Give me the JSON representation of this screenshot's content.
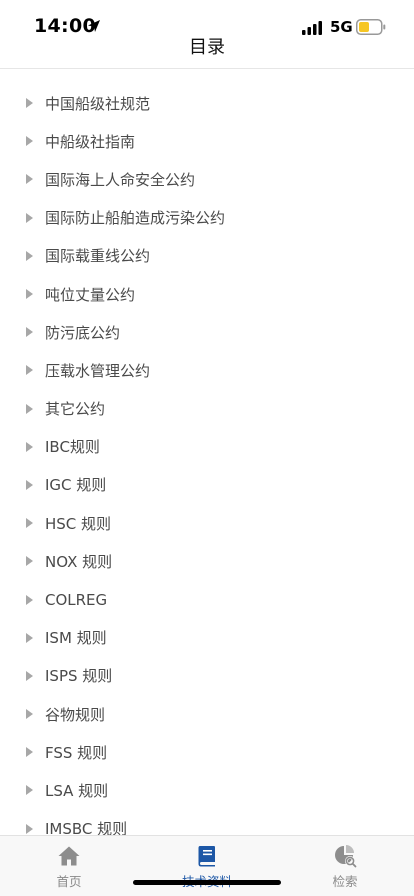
{
  "status_bar": {
    "time": "14:00",
    "network": "5G",
    "icons": [
      "location-arrow-icon",
      "signal-icon",
      "battery-icon"
    ]
  },
  "nav": {
    "title": "目录"
  },
  "catalog": {
    "items": [
      {
        "label": "中国船级社规范"
      },
      {
        "label": "中船级社指南"
      },
      {
        "label": "国际海上人命安全公约"
      },
      {
        "label": "国际防止船舶造成污染公约"
      },
      {
        "label": "国际载重线公约"
      },
      {
        "label": "吨位丈量公约"
      },
      {
        "label": "防污底公约"
      },
      {
        "label": "压载水管理公约"
      },
      {
        "label": "其它公约"
      },
      {
        "label": "IBC规则"
      },
      {
        "label": "IGC 规则"
      },
      {
        "label": "HSC 规则"
      },
      {
        "label": "NOX 规则"
      },
      {
        "label": "COLREG"
      },
      {
        "label": "ISM 规则"
      },
      {
        "label": "ISPS 规则"
      },
      {
        "label": "谷物规则"
      },
      {
        "label": "FSS 规则"
      },
      {
        "label": "LSA 规则"
      },
      {
        "label": "IMSBC 规则"
      }
    ]
  },
  "tab_bar": {
    "tabs": [
      {
        "label": "首页",
        "icon": "home-icon"
      },
      {
        "label": "技术资料",
        "icon": "book-icon",
        "active": true
      },
      {
        "label": "检索",
        "icon": "search-chart-icon"
      }
    ],
    "active_color": "#1d57a6",
    "inactive_color": "#8a8a8a"
  }
}
